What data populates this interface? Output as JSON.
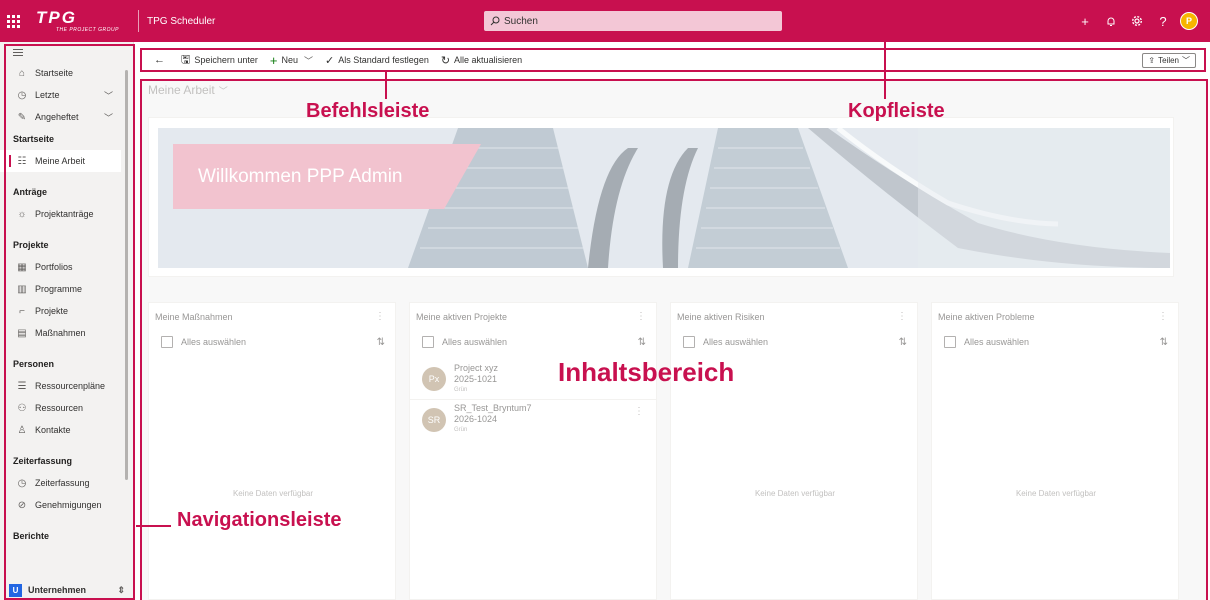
{
  "header": {
    "logo_text": "TPG",
    "logo_sub": "THE PROJECT GROUP",
    "app_title": "TPG Scheduler",
    "search_placeholder": "Suchen",
    "avatar_initial": "P"
  },
  "sidebar": {
    "top_items": [
      {
        "label": "Startseite",
        "icon": "home-icon"
      },
      {
        "label": "Letzte",
        "icon": "clock-icon"
      },
      {
        "label": "Angeheftet",
        "icon": "pin-icon"
      }
    ],
    "sections": [
      {
        "title": "Startseite",
        "items": [
          {
            "label": "Meine Arbeit",
            "icon": "tasks-icon",
            "active": true
          }
        ]
      },
      {
        "title": "Anträge",
        "items": [
          {
            "label": "Projektanträge",
            "icon": "lightbulb-icon"
          }
        ]
      },
      {
        "title": "Projekte",
        "items": [
          {
            "label": "Portfolios",
            "icon": "portfolio-icon"
          },
          {
            "label": "Programme",
            "icon": "program-icon"
          },
          {
            "label": "Projekte",
            "icon": "project-icon"
          },
          {
            "label": "Maßnahmen",
            "icon": "measures-icon"
          }
        ]
      },
      {
        "title": "Personen",
        "items": [
          {
            "label": "Ressourcenpläne",
            "icon": "resource-plan-icon"
          },
          {
            "label": "Ressourcen",
            "icon": "resources-icon"
          },
          {
            "label": "Kontakte",
            "icon": "contact-icon"
          }
        ]
      },
      {
        "title": "Zeiterfassung",
        "items": [
          {
            "label": "Zeiterfassung",
            "icon": "clock-icon"
          },
          {
            "label": "Genehmigungen",
            "icon": "check-circle-icon"
          }
        ]
      },
      {
        "title": "Berichte",
        "items": []
      }
    ],
    "area_badge": "U",
    "area_label": "Unternehmen"
  },
  "commandbar": {
    "save_as": "Speichern unter",
    "new": "Neu",
    "set_default": "Als Standard festlegen",
    "refresh_all": "Alle aktualisieren",
    "share": "Teilen"
  },
  "content": {
    "page_title": "Meine Arbeit",
    "welcome": "Willkommen PPP Admin",
    "select_all": "Alles auswählen",
    "no_data": "Keine Daten verfügbar",
    "cards": [
      {
        "title": "Meine Maßnahmen",
        "items": []
      },
      {
        "title": "Meine aktiven Projekte",
        "items": [
          {
            "initials": "Px",
            "name": "Project xyz",
            "number": "2025-1021",
            "status": "Grün"
          },
          {
            "initials": "SR",
            "name": "SR_Test_Bryntum7",
            "number": "2026-1024",
            "status": "Grün"
          }
        ]
      },
      {
        "title": "Meine aktiven Risiken",
        "items": []
      },
      {
        "title": "Meine aktiven Probleme",
        "items": []
      }
    ]
  },
  "annotations": {
    "commandbar": "Befehlsleiste",
    "header": "Kopfleiste",
    "content": "Inhaltsbereich",
    "navigation": "Navigationsleiste"
  },
  "colors": {
    "brand": "#c8104f",
    "search_bg": "#f3c7d6",
    "banner": "#e995a9",
    "nav_bg": "#f3f2f1"
  }
}
